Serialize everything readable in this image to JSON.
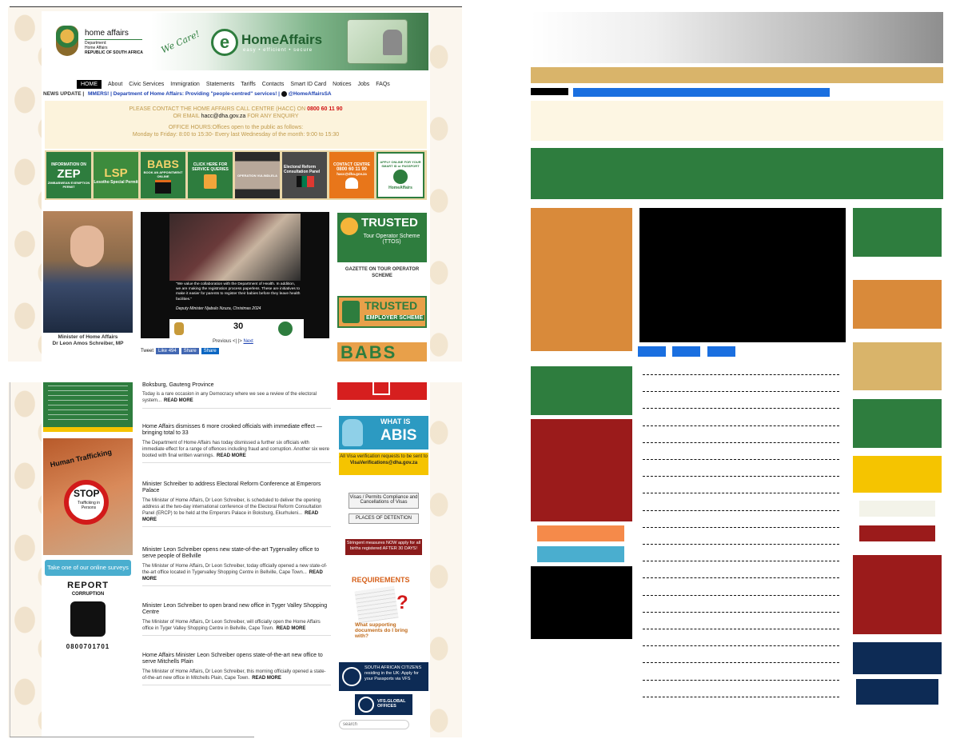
{
  "colors": {
    "brand_green": "#2e7d3e",
    "dha_gold": "#d9b46a",
    "accent_red": "#9b1b1b",
    "accent_navy": "#0d2b55",
    "accent_yellow": "#f5c400",
    "link_blue": "#1a6fe0"
  },
  "header": {
    "logo_name": "home affairs",
    "logo_dept": "Department:",
    "logo_dept2": "Home Affairs",
    "logo_country": "REPUBLIC OF SOUTH AFRICA",
    "slogan": "We Care!",
    "ehome_brand": "HomeAffairs",
    "ehome_tagline": "easy • efficient • secure"
  },
  "nav": [
    "HOME",
    "About",
    "Civic Services",
    "Immigration",
    "Statements",
    "Tariffs",
    "Contacts",
    "Smart ID Card",
    "Notices",
    "Jobs",
    "FAQs"
  ],
  "news_update": {
    "label": "NEWS UPDATE |",
    "text": "MMERS! | Department of Home Affairs: Providing \"people-centred\" services! |",
    "handle": "@HomeAffairsSA"
  },
  "notice": {
    "line1": "PLEASE CONTACT THE HOME AFFAIRS CALL CENTRE (HACC) ON",
    "phone": "0800 60 11 90",
    "line2_pre": "OR EMAIL",
    "email": "hacc@dha.gov.za",
    "line2_post": "FOR ANY ENQUIRY",
    "hours_title": "OFFICE HOURS:Offices open to the public as follows:",
    "hours": "Monday to Friday: 8:00 to 15:30- Every last Wednesday of the month: 9:00 to 15:30"
  },
  "tiles": [
    {
      "title": "INFORMATION ON",
      "big": "ZEP",
      "sub": "ZIMBABWEAN EXEMPTION PERMIT"
    },
    {
      "title": "",
      "big": "LSP",
      "sub": "Lesotho Special Permit"
    },
    {
      "title": "",
      "big": "BABS",
      "sub": "BOOK AN APPOINTMENT ONLINE"
    },
    {
      "title": "CLICK HERE FOR",
      "big": "",
      "sub": "SERVICE QUERIES"
    },
    {
      "title": "OPERATION VULINDLELA",
      "big": "",
      "sub": ""
    },
    {
      "title": "Electoral Reform Consultation Panel",
      "big": "",
      "sub": ""
    },
    {
      "title": "CONTACT CENTRE",
      "big": "0800 60 11 90",
      "sub": "hacc@dha.gov.za"
    },
    {
      "title": "APPLY ONLINE FOR YOUR SMART ID or PASSPORT",
      "big": "",
      "sub": "HomeAffairs"
    }
  ],
  "minister": {
    "caption1": "Minister of Home Affairs",
    "caption2": "Dr Leon Amos Schreiber, MP"
  },
  "slide": {
    "quote": "\"We value the collaboration with the Department of Health. In addition, we are making the registration process paperless. These are initiatives to make it easier for parents to register their babies before they leave health facilities.\"",
    "attribution": "Deputy Minister Njabulo Nzuza, Christmas 2024",
    "pager_prev": "Previous",
    "pager_sep": "<| |>",
    "pager_next": "Next"
  },
  "social": {
    "tweet": "Tweet",
    "like": "Like 494",
    "share": "Share",
    "share2": "Share"
  },
  "right_col": {
    "ttos_title": "TRUSTED",
    "ttos_sub": "Tour Operator Scheme (TTOS)",
    "gazette": "GAZETTE ON TOUR OPERATOR SCHEME",
    "employer_title": "TRUSTED",
    "employer_sub": "EMPLOYER SCHEME",
    "babs": "BABS",
    "abis_title": "WHAT IS",
    "abis_big": "ABIS",
    "visa_note": "All Visa verification requests to be sent to",
    "visa_email": "VisaVerifications@dha.gov.za",
    "visa_btn": "Visas / Permits Compliance and Cancellations of Visas",
    "detention_btn": "PLACES OF DETENTION",
    "stringent": "Stringent measures NOW apply for all births registered AFTER 30 DAYS!",
    "req_title": "REQUIREMENTS",
    "req_q": "What supporting documents do I bring with?",
    "vfs_text": "SOUTH AFRICAN CITIZENS residing in the UK: Apply for your Passports via VFS",
    "vfs_offices": "VFS.GLOBAL OFFICES",
    "search_placeholder": "search"
  },
  "left_col": {
    "trafficking_title": "Human Trafficking",
    "stop": "STOP",
    "stop_sub": "Trafficking in Persons",
    "survey": "Take one of our online surveys",
    "report": "REPORT",
    "corruption": "CORRUPTION",
    "report_phone": "0800701701"
  },
  "news": [
    {
      "title": "Boksburg, Gauteng Province",
      "body": "Today is a rare occasion in any Democracy where we  see a review of the electoral system...",
      "more": "READ MORE"
    },
    {
      "title": "Home Affairs dismisses 6 more crooked officials with immediate effect — bringing total to 33",
      "body": "The Department of Home Affairs has today dismissed a further six officials with immediate effect for a range of offences including fraud and corruption. Another six were booted with final written warnings.",
      "more": "READ MORE"
    },
    {
      "title": "Minister Schreiber to address Electoral Reform Conference at Emperors Palace",
      "body": "The Minister of Home Affairs, Dr Leon Schreiber, is scheduled to deliver the opening address at the two-day international conference of the Electoral Reform Consultation Panel (ERCP) to be held at the Emperors Palace in Boksburg, Ekurhuleni...",
      "more": "READ MORE"
    },
    {
      "title": "Minister Leon Schreiber opens new state-of-the-art Tygervalley office to serve people of Bellville",
      "body": "The Minister of Home Affairs, Dr Leon Schreiber, today officially opened a new state-of-the-art office located in Tygervalley Shopping Centre in Bellville, Cape Town...",
      "more": "READ MORE"
    },
    {
      "title": "Minister Leon Schreiber to open brand new office in Tyger Valley Shopping Centre",
      "body": "The Minister of Home Affairs, Dr Leon Schreiber, will officially open the Home Affairs office in Tyger Valley Shopping Centre in Bellville, Cape Town.",
      "more": "READ MORE"
    },
    {
      "title": "Home Affairs Minister Leon Schreiber opens state-of-the-art new office to serve Mitchells Plain",
      "body": "The Minister of Home Affairs, Dr Leon Schreiber, this morning officially opened a state-of-the-art new office in Mitchells Plain, Cape Town.",
      "more": "READ MORE"
    }
  ]
}
